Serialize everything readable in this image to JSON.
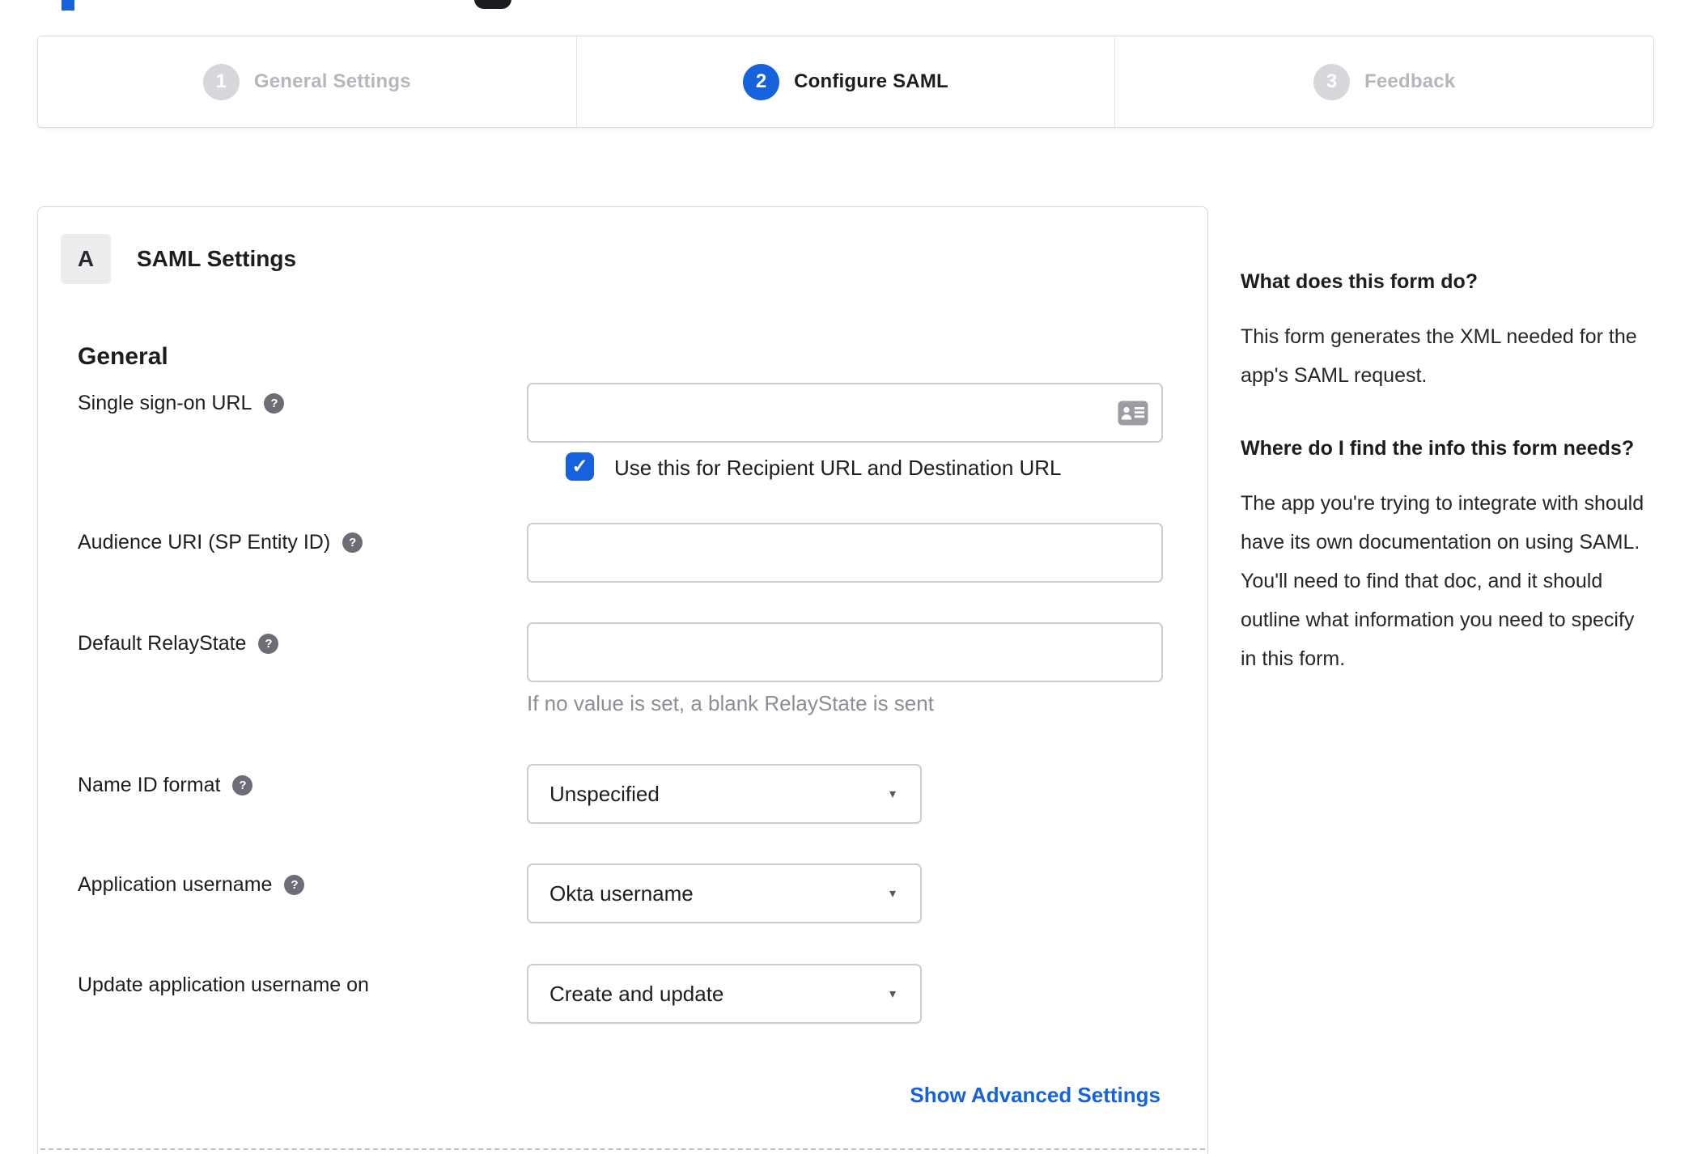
{
  "colors": {
    "accent": "#1662dd",
    "inactive_step": "#d6d7da",
    "text": "#1d1d21",
    "muted_text": "#8d8d95",
    "link": "#1662dd"
  },
  "icons": {
    "question": "?",
    "checkmark": "✓",
    "dropdown_arrow": "▾",
    "contact_card": "contact-card-icon"
  },
  "stepper": {
    "steps": [
      {
        "number": "1",
        "label": "General Settings",
        "state": "inactive"
      },
      {
        "number": "2",
        "label": "Configure SAML",
        "state": "active"
      },
      {
        "number": "3",
        "label": "Feedback",
        "state": "inactive"
      }
    ]
  },
  "panel": {
    "section_badge": "A",
    "section_title": "SAML Settings",
    "group_title": "General",
    "fields": [
      {
        "label": "Single sign-on URL",
        "has_help": true,
        "type": "text",
        "value": "",
        "checkbox": {
          "checked": true,
          "label": "Use this for Recipient URL and Destination URL"
        }
      },
      {
        "label": "Audience URI (SP Entity ID)",
        "has_help": true,
        "type": "text",
        "value": ""
      },
      {
        "label": "Default RelayState",
        "has_help": true,
        "type": "text",
        "value": "",
        "hint": "If no value is set, a blank RelayState is sent"
      },
      {
        "label": "Name ID format",
        "has_help": true,
        "type": "select",
        "value": "Unspecified"
      },
      {
        "label": "Application username",
        "has_help": true,
        "type": "select",
        "value": "Okta username"
      },
      {
        "label": "Update application username on",
        "has_help": false,
        "type": "select",
        "value": "Create and update"
      }
    ],
    "advanced_link": "Show Advanced Settings"
  },
  "sidebar": {
    "sections": [
      {
        "heading": "What does this form do?",
        "body": "This form generates the XML needed for the app's SAML request."
      },
      {
        "heading": "Where do I find the info this form needs?",
        "body": "The app you're trying to integrate with should have its own documentation on using SAML. You'll need to find that doc, and it should outline what information you need to specify in this form."
      }
    ]
  }
}
